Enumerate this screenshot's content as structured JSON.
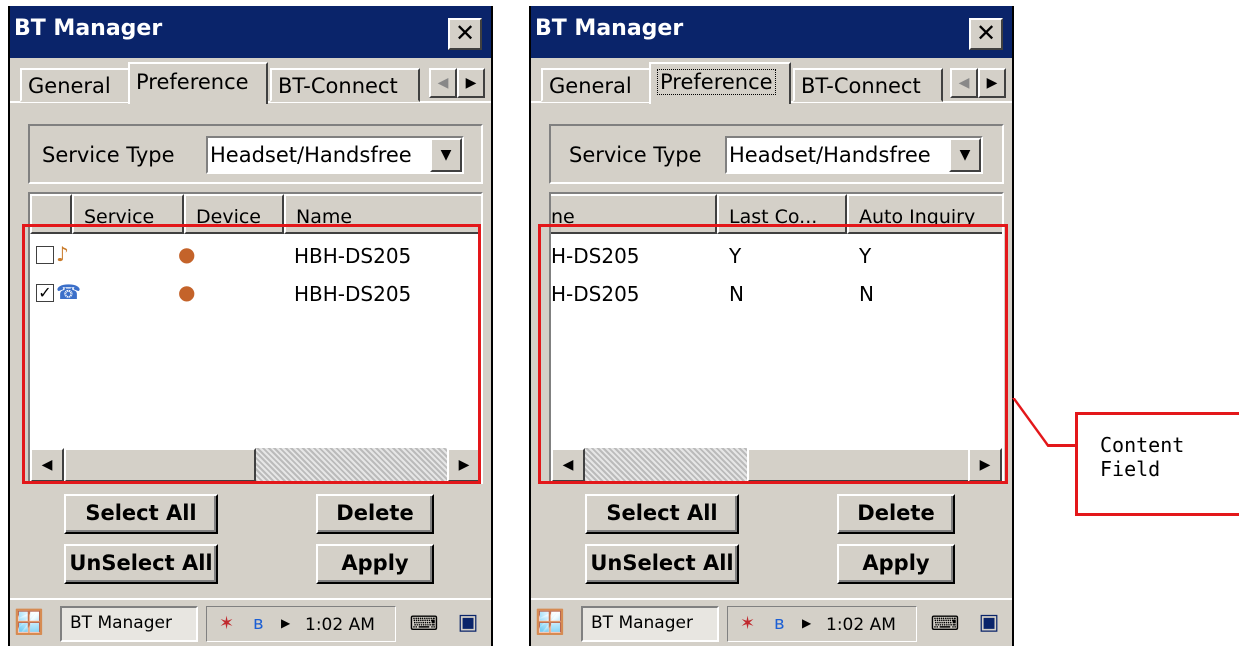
{
  "window_title": "BT Manager",
  "close_glyph": "✕",
  "tabs": [
    "General",
    "Preference",
    "BT-Connect"
  ],
  "service_type_label": "Service Type",
  "service_type_value": "Headset/Handsfree",
  "left_panel": {
    "columns": [
      "Service",
      "Device",
      "Name"
    ],
    "rows": [
      {
        "checked": false,
        "name": "HBH-DS205"
      },
      {
        "checked": true,
        "name": "HBH-DS205"
      }
    ]
  },
  "right_panel": {
    "columns": [
      "ne",
      "Last Co...",
      "Auto Inquiry"
    ],
    "rows": [
      {
        "name": "H-DS205",
        "last_connected": "Y",
        "auto_inquiry": "Y"
      },
      {
        "name": "H-DS205",
        "last_connected": "N",
        "auto_inquiry": "N"
      }
    ]
  },
  "buttons": {
    "select_all": "Select All",
    "delete": "Delete",
    "unselect_all": "UnSelect All",
    "apply": "Apply"
  },
  "taskbar": {
    "app_label": "BT Manager",
    "time": "1:02 AM"
  },
  "callout": {
    "line1": "Content",
    "line2": "Field"
  },
  "colors": {
    "title_bar": "#0a246a",
    "highlight": "#e3171a",
    "face": "#d4d0c8"
  },
  "icons": [
    "close-icon",
    "scroll-left-icon",
    "scroll-right-icon",
    "dropdown-arrow-icon",
    "headset-icon",
    "handsfree-icon",
    "device-icon",
    "start-icon",
    "bluetooth-icon",
    "keyboard-icon",
    "desktop-icon"
  ]
}
